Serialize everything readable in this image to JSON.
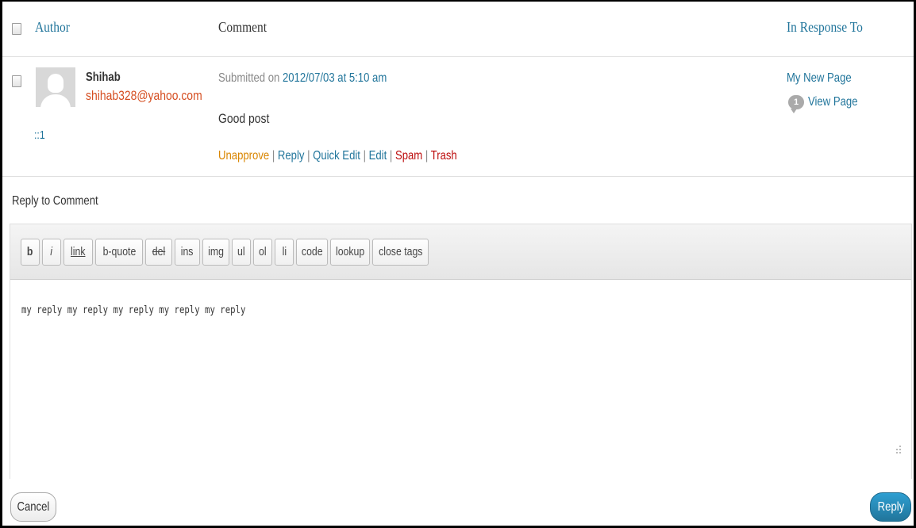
{
  "table": {
    "headers": {
      "author": "Author",
      "comment": "Comment",
      "in_response_to": "In Response To"
    }
  },
  "comment": {
    "author_name": "Shihab",
    "author_email": "shihab328@yahoo.com",
    "author_ip": "::1",
    "submitted_prefix": "Submitted on",
    "submitted_date": "2012/07/03 at 5:10 am",
    "text": "Good post",
    "actions": {
      "unapprove": "Unapprove",
      "reply": "Reply",
      "quick_edit": "Quick Edit",
      "edit": "Edit",
      "spam": "Spam",
      "trash": "Trash",
      "separator": " | "
    },
    "response": {
      "post_title": "My New Page",
      "comment_count": "1",
      "view_link": "View Page"
    }
  },
  "reply": {
    "title": "Reply to Comment",
    "toolbar": [
      "b",
      "i",
      "link",
      "b-quote",
      "del",
      "ins",
      "img",
      "ul",
      "ol",
      "li",
      "code",
      "lookup",
      "close tags"
    ],
    "textarea_value": "my reply my reply my reply my reply my reply",
    "cancel_label": "Cancel",
    "submit_label": "Reply"
  },
  "colors": {
    "link": "#21759b",
    "email": "#d54e21",
    "unapprove": "#d98500",
    "danger": "#bc0b0b",
    "primary_button": "#21759b"
  },
  "icons": {
    "select_checkbox": "checkbox-icon",
    "avatar": "default-avatar-icon",
    "comment_count": "comment-bubble-icon",
    "resize": "resize-handle-icon"
  }
}
